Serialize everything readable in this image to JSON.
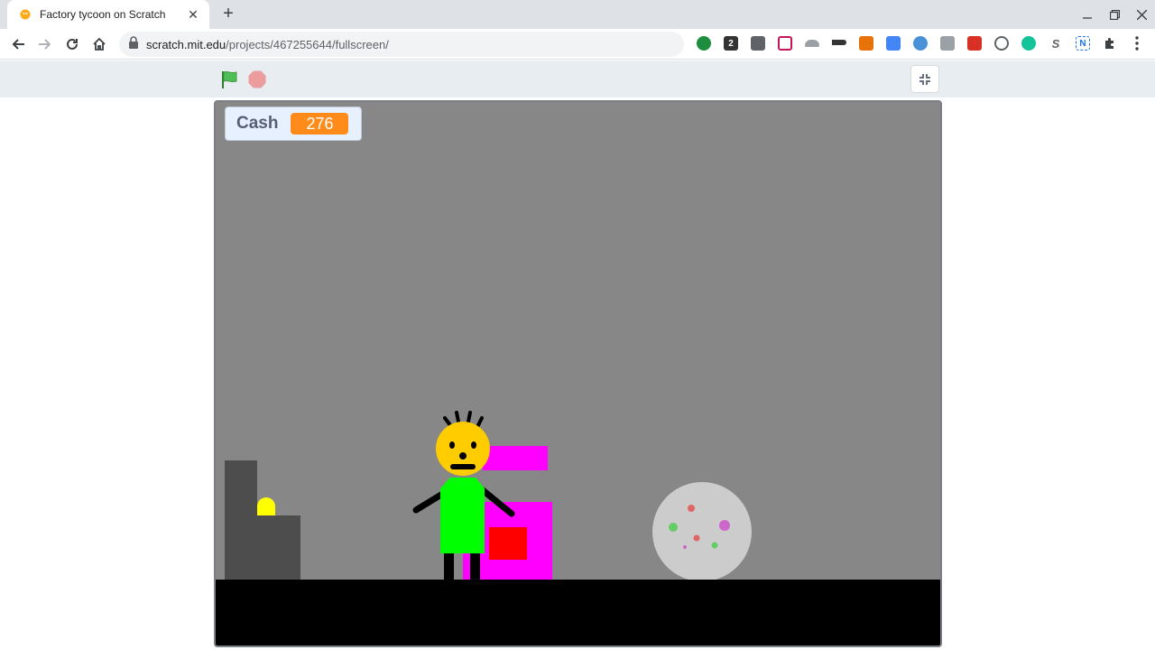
{
  "browser": {
    "tab_title": "Factory tycoon on Scratch",
    "url_host": "scratch.mit.edu",
    "url_path": "/projects/467255644/fullscreen/"
  },
  "icons": {
    "favicon": "scratch-cat-icon",
    "tab_close": "close-icon",
    "new_tab": "plus-icon",
    "minimize": "minimize-icon",
    "restore": "restore-icon",
    "close_window": "close-window-icon",
    "back": "back-arrow-icon",
    "forward": "forward-arrow-icon",
    "reload": "reload-icon",
    "home": "home-icon",
    "lock": "lock-icon",
    "camera": "camera-icon",
    "bookmark": "star-icon",
    "extensions": "puzzle-icon",
    "menu": "kebab-menu-icon"
  },
  "extension_label_2": "2",
  "extension_label_s": "S",
  "extension_label_n": "N",
  "scratch": {
    "green_flag": "green-flag-icon",
    "stop": "stop-sign-icon",
    "unfullscreen": "unfullscreen-icon"
  },
  "stage": {
    "monitor_label": "Cash",
    "monitor_value": "276",
    "colors": {
      "background": "#878787",
      "ground": "#000000",
      "machine": "#ff00ff",
      "character_body": "#00ff00",
      "character_head": "#ffcc00",
      "box": "#ff0000",
      "building": "#4d4d4d",
      "coin": "#ffff00",
      "orb": "#cccccc"
    }
  }
}
